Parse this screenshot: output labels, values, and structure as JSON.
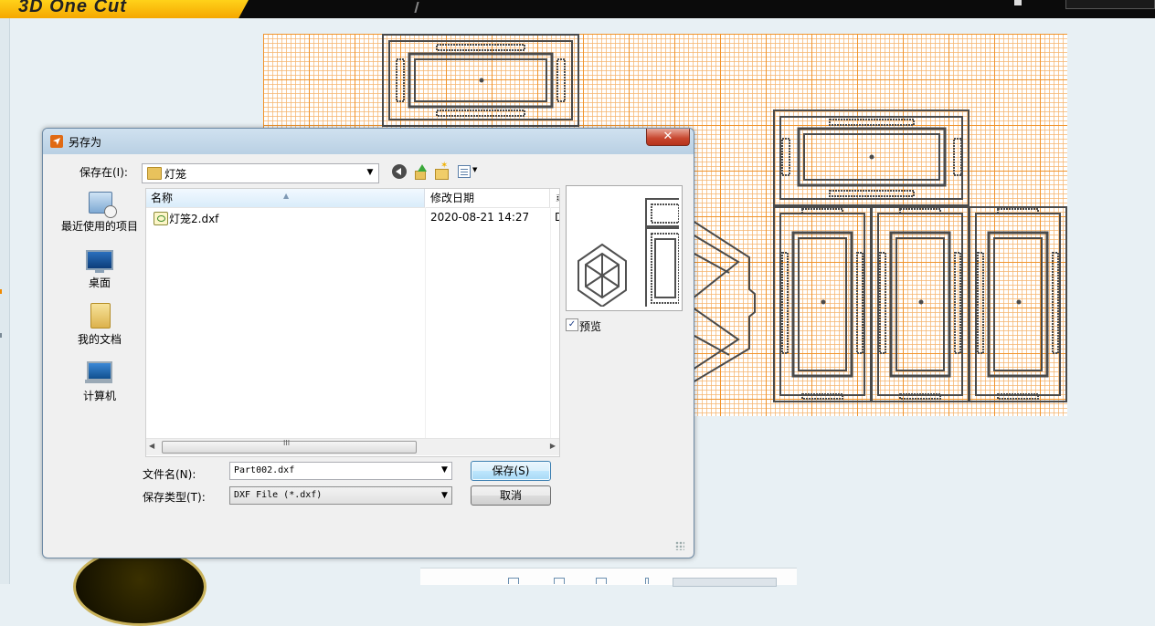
{
  "app": {
    "logo_text": "3D One Cut"
  },
  "dialog": {
    "title": "另存为",
    "close_symbol": "✕",
    "location": {
      "label": "保存在(I):",
      "value": "灯笼"
    },
    "places": [
      {
        "label": "最近使用的项目",
        "icon": "recent-items-icon"
      },
      {
        "label": "桌面",
        "icon": "desktop-icon"
      },
      {
        "label": "我的文档",
        "icon": "documents-icon"
      },
      {
        "label": "计算机",
        "icon": "computer-icon"
      }
    ],
    "columns": {
      "name": "名称",
      "date": "修改日期",
      "extra": "፤"
    },
    "files": [
      {
        "name": "灯笼2.dxf",
        "date": "2020-08-21 14:27",
        "extra": "D"
      }
    ],
    "scrollbar_grip": "III",
    "preview": {
      "checked": true,
      "label": "预览"
    },
    "filename": {
      "label": "文件名(N):",
      "value": "Part002.dxf"
    },
    "filetype": {
      "label": "保存类型(T):",
      "value": "DXF File (*.dxf)"
    },
    "buttons": {
      "save": "保存(S)",
      "cancel": "取消"
    }
  },
  "colors": {
    "grid_major": "#f09228",
    "grid_minor": "#f6b46e",
    "part_outline": "#4a4a4a",
    "dialog_bg": "#f0f0f0",
    "close_button": "#c7452d"
  }
}
